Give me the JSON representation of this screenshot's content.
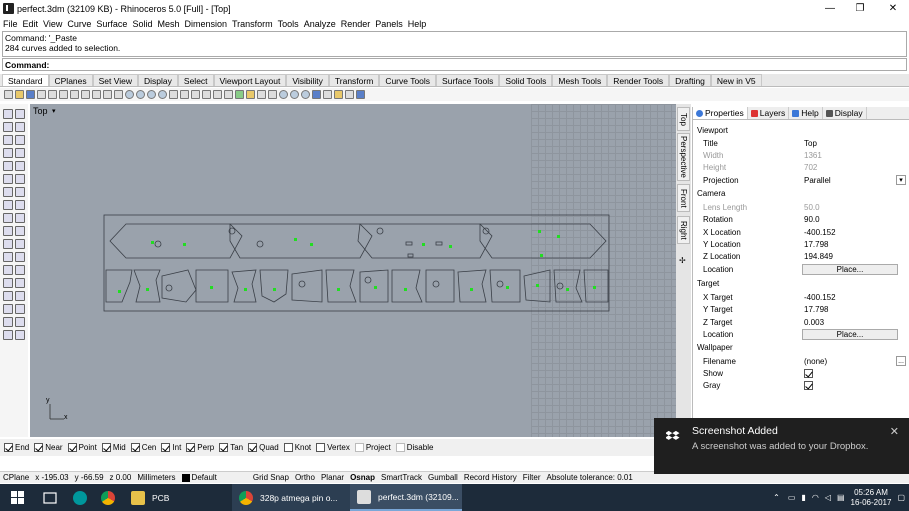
{
  "window": {
    "title": "perfect.3dm (32109 KB) - Rhinoceros 5.0 [Full] - [Top]",
    "minimize_glyph": "—",
    "restore_glyph": "❐",
    "close_glyph": "✕"
  },
  "menu": [
    "File",
    "Edit",
    "View",
    "Curve",
    "Surface",
    "Solid",
    "Mesh",
    "Dimension",
    "Transform",
    "Tools",
    "Analyze",
    "Render",
    "Panels",
    "Help"
  ],
  "command": {
    "history_line1": "Command: '_Paste",
    "history_line2": "284 curves added to selection.",
    "prompt": "Command:"
  },
  "toolbar_tabs": [
    "Standard",
    "CPlanes",
    "Set View",
    "Display",
    "Select",
    "Viewport Layout",
    "Visibility",
    "Transform",
    "Curve Tools",
    "Surface Tools",
    "Solid Tools",
    "Mesh Tools",
    "Render Tools",
    "Drafting",
    "New in V5"
  ],
  "viewport": {
    "label": "Top",
    "label_arrow": "▾",
    "axis_y": "y",
    "axis_x": "x"
  },
  "viewport_tabs": [
    "Top",
    "Perspective",
    "Front",
    "Right"
  ],
  "viewport_tab_more": "✢",
  "panel": {
    "tabs": [
      "Properties",
      "Layers",
      "Help",
      "Display"
    ],
    "sections": {
      "viewport": "Viewport",
      "camera": "Camera",
      "target": "Target",
      "wallpaper": "Wallpaper"
    },
    "rows": {
      "title": {
        "label": "Title",
        "value": "Top"
      },
      "width": {
        "label": "Width",
        "value": "1361"
      },
      "height": {
        "label": "Height",
        "value": "702"
      },
      "projection": {
        "label": "Projection",
        "value": "Parallel"
      },
      "lens_length": {
        "label": "Lens Length",
        "value": "50.0"
      },
      "rotation": {
        "label": "Rotation",
        "value": "90.0"
      },
      "x_location": {
        "label": "X Location",
        "value": "-400.152"
      },
      "y_location": {
        "label": "Y Location",
        "value": "17.798"
      },
      "z_location": {
        "label": "Z Location",
        "value": "194.849"
      },
      "location": {
        "label": "Location",
        "value": "Place..."
      },
      "x_target": {
        "label": "X Target",
        "value": "-400.152"
      },
      "y_target": {
        "label": "Y Target",
        "value": "17.798"
      },
      "z_target": {
        "label": "Z Target",
        "value": "0.003"
      },
      "target_location": {
        "label": "Location",
        "value": "Place..."
      },
      "filename": {
        "label": "Filename",
        "value": "(none)"
      },
      "filename_browse": "...",
      "show": {
        "label": "Show"
      },
      "gray": {
        "label": "Gray"
      }
    }
  },
  "osnap": [
    {
      "label": "End",
      "checked": true
    },
    {
      "label": "Near",
      "checked": true
    },
    {
      "label": "Point",
      "checked": true
    },
    {
      "label": "Mid",
      "checked": true
    },
    {
      "label": "Cen",
      "checked": true
    },
    {
      "label": "Int",
      "checked": true
    },
    {
      "label": "Perp",
      "checked": true
    },
    {
      "label": "Tan",
      "checked": true
    },
    {
      "label": "Quad",
      "checked": true
    },
    {
      "label": "Knot",
      "checked": false
    },
    {
      "label": "Vertex",
      "checked": false
    },
    {
      "label": "Project",
      "checked": false
    },
    {
      "label": "Disable",
      "checked": false
    }
  ],
  "status": {
    "cplane": "CPlane",
    "x": "x -195.03",
    "y": "y -66.59",
    "z": "z 0.00",
    "units": "Millimeters",
    "layer": "Default",
    "grid_snap": "Grid Snap",
    "ortho": "Ortho",
    "planar": "Planar",
    "osnap": "Osnap",
    "smarttrack": "SmartTrack",
    "gumball": "Gumball",
    "record_history": "Record History",
    "filter": "Filter",
    "tolerance": "Absolute tolerance: 0.01"
  },
  "taskbar": {
    "items": [
      {
        "label": "PCB",
        "icon": "folder-icon"
      },
      {
        "label": "328p atmega pin o...",
        "icon": "chrome-icon"
      },
      {
        "label": "perfect.3dm (32109...",
        "icon": "rhino-icon"
      }
    ],
    "time": "05:26 AM",
    "date": "16-06-2017"
  },
  "toast": {
    "title": "Screenshot Added",
    "body": "A screenshot was added to your Dropbox."
  },
  "colors": {
    "viewport_bg": "#9aa2ac",
    "curve_color": "#3a3f47",
    "point_color": "#22dd22",
    "taskbar_bg": "#1d2b3a",
    "toast_bg": "#1f1f1f"
  }
}
